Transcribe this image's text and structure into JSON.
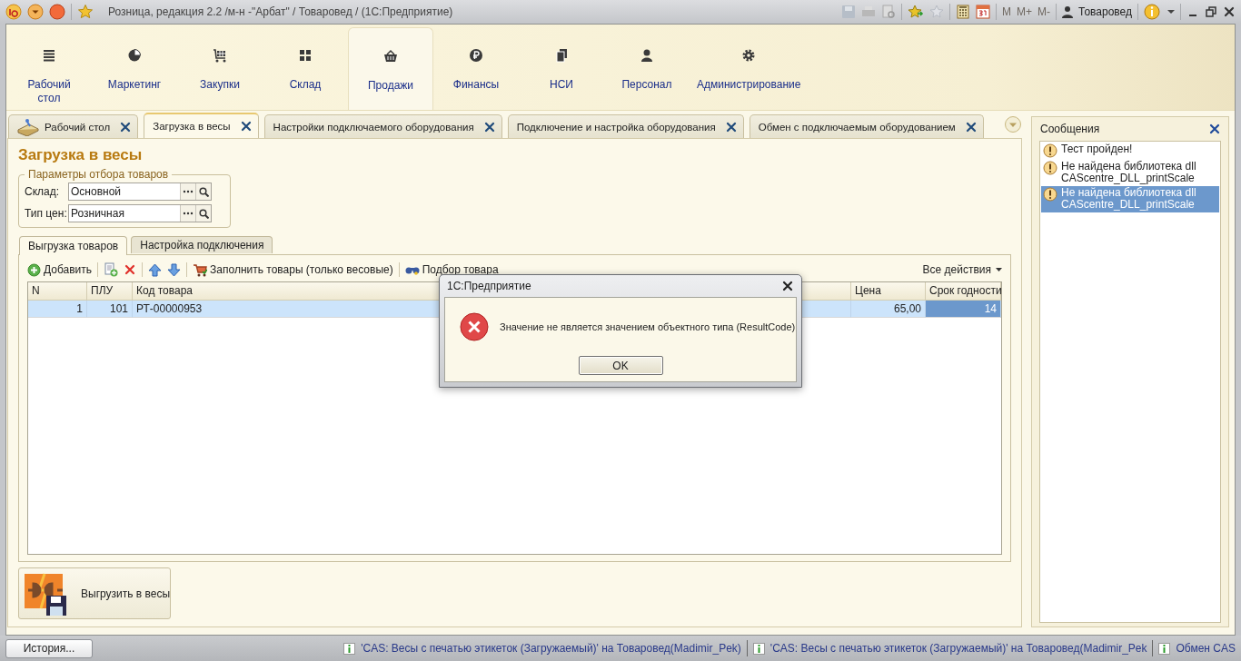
{
  "window": {
    "title": "Розница, редакция 2.2 /м-н -\"Арбат\" / Товаровед /  (1С:Предприятие)",
    "memory_buttons": [
      "M",
      "M+",
      "M-"
    ],
    "user": "Товаровед"
  },
  "sections": [
    {
      "label": "Рабочий стол",
      "selected": false
    },
    {
      "label": "Маркетинг",
      "selected": false
    },
    {
      "label": "Закупки",
      "selected": false
    },
    {
      "label": "Склад",
      "selected": false
    },
    {
      "label": "Продажи",
      "selected": true
    },
    {
      "label": "Финансы",
      "selected": false
    },
    {
      "label": "НСИ",
      "selected": false
    },
    {
      "label": "Персонал",
      "selected": false
    },
    {
      "label": "Администрирование",
      "selected": false
    }
  ],
  "open_tabs": [
    {
      "label": "Рабочий стол",
      "selected": false
    },
    {
      "label": "Загрузка в весы",
      "selected": true
    },
    {
      "label": "Настройки подключаемого оборудования",
      "selected": false
    },
    {
      "label": "Подключение и настройка оборудования",
      "selected": false
    },
    {
      "label": "Обмен с подключаемым оборудованием",
      "selected": false
    }
  ],
  "form": {
    "title": "Загрузка в весы",
    "filter_group": {
      "title": "Параметры отбора товаров",
      "fields": [
        {
          "label": "Склад:",
          "value": "Основной"
        },
        {
          "label": "Тип цен:",
          "value": "Розничная"
        }
      ]
    },
    "inner_tabs": [
      {
        "label": "Выгрузка товаров",
        "selected": true
      },
      {
        "label": "Настройка подключения",
        "selected": false
      }
    ],
    "toolbar": {
      "add": "Добавить",
      "fill": "Заполнить товары (только весовые)",
      "pick": "Подбор товара",
      "all_actions": "Все действия"
    },
    "table": {
      "columns": [
        "N",
        "ПЛУ",
        "Код товара",
        "Цена",
        "Срок годности"
      ],
      "rows": [
        {
          "cells": [
            "1",
            "101",
            "РТ-00000953",
            "65,00",
            "14"
          ],
          "selected": true
        }
      ]
    },
    "upload_button": "Выгрузить в весы"
  },
  "messages": {
    "title": "Сообщения",
    "items": [
      {
        "text": "Тест пройден!",
        "selected": false
      },
      {
        "text": "Не найдена библиотека dll CAScentre_DLL_printScale",
        "selected": false
      },
      {
        "text": "Не найдена библиотека dll CAScentre_DLL_printScale",
        "selected": true
      }
    ]
  },
  "status_bar": {
    "history_button": "История...",
    "notifications": [
      "'CAS: Весы с печатью этикеток (Загружаемый)' на Товаровед(Madimir_Pek)",
      "'CAS: Весы с печатью этикеток (Загружаемый)' на Товаровед(Madimir_Pek",
      "Обмен CAS"
    ]
  },
  "dialog": {
    "title": "1С:Предприятие",
    "message": "Значение не является значением объектного типа (ResultCode)",
    "button": "OK"
  }
}
